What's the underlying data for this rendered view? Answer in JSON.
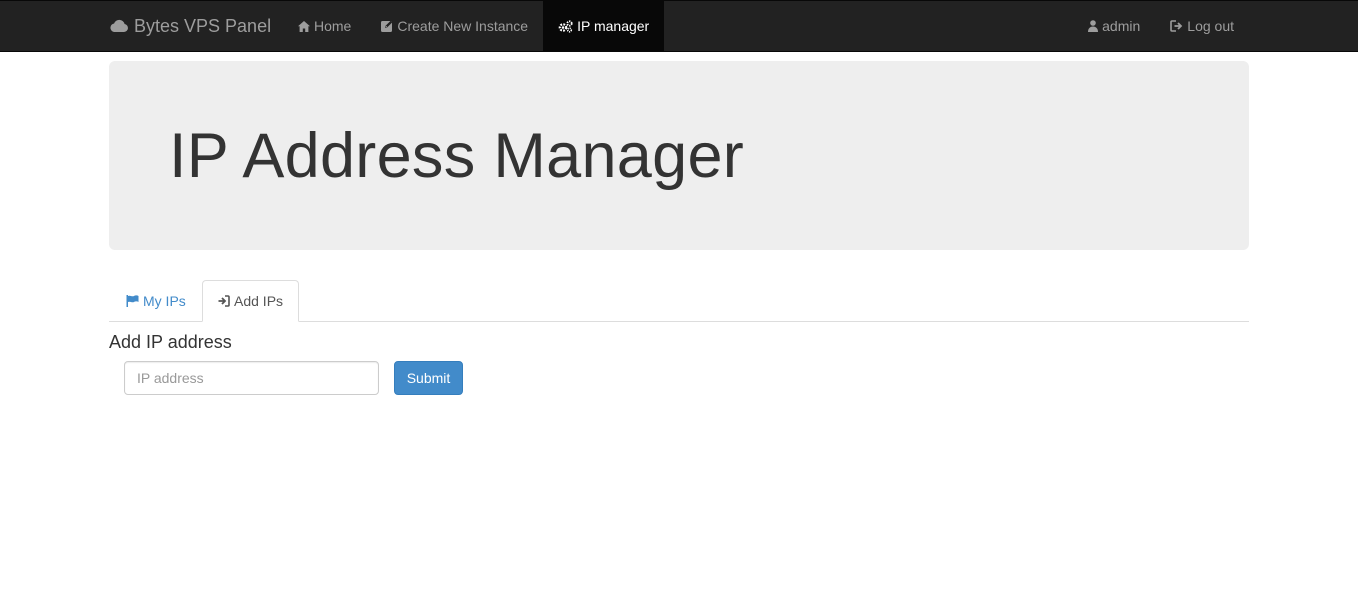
{
  "navbar": {
    "brand": {
      "label": "Bytes VPS Panel",
      "icon": "cloud-icon"
    },
    "left_items": [
      {
        "label": "Home",
        "icon": "home-icon"
      },
      {
        "label": "Create New Instance",
        "icon": "edit-icon"
      },
      {
        "label": "IP manager",
        "icon": "cogs-icon",
        "active": true
      }
    ],
    "right_items": [
      {
        "label": "admin",
        "icon": "user-icon"
      },
      {
        "label": "Log out",
        "icon": "logout-icon"
      }
    ]
  },
  "jumbotron": {
    "title": "IP Address Manager"
  },
  "tabs": [
    {
      "label": "My IPs",
      "icon": "flag-icon"
    },
    {
      "label": "Add IPs",
      "icon": "login-icon",
      "active": true
    }
  ],
  "form": {
    "heading": "Add IP address",
    "ip_input": {
      "placeholder": "IP address",
      "value": ""
    },
    "submit_label": "Submit"
  },
  "colors": {
    "navbar_bg": "#222222",
    "navbar_text": "#9d9d9d",
    "navbar_active_bg": "#080808",
    "jumbotron_bg": "#eeeeee",
    "link": "#428bca",
    "primary_button": "#428bca"
  }
}
